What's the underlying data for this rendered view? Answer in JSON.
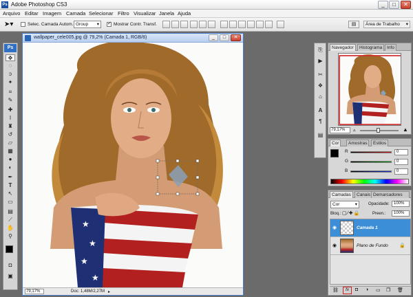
{
  "app": {
    "title": "Adobe Photoshop CS3",
    "logo": "Ps"
  },
  "window_controls": {
    "minimize": "_",
    "maximize": "□",
    "close": "✕"
  },
  "menu": [
    "Arquivo",
    "Editar",
    "Imagem",
    "Camada",
    "Selecionar",
    "Filtro",
    "Visualizar",
    "Janela",
    "Ajuda"
  ],
  "options_bar": {
    "auto_select_label": "Selec. Camada Autom.",
    "auto_select_value": "Group",
    "show_transform_label": "Mostrar Contr. Transf.",
    "workspace_label": "Área de Trabalho"
  },
  "document": {
    "title": "wallpaper_cele005.jpg @ 79,2% (Camada 1, RGB/8)",
    "zoom": "79,17%",
    "doc_info": "Doc: 1,48M/2,27M"
  },
  "navigator": {
    "tabs": [
      "Navegador",
      "Histograma",
      "Info"
    ],
    "zoom": "79,17%"
  },
  "color_panel": {
    "tabs": [
      "Cor",
      "Amostras",
      "Estilos"
    ],
    "channels": [
      {
        "label": "R",
        "value": "0"
      },
      {
        "label": "G",
        "value": "0"
      },
      {
        "label": "B",
        "value": "0"
      }
    ],
    "colors": {
      "red": "#d01818",
      "green": "#18a018",
      "blue": "#1838d0"
    }
  },
  "layers_panel": {
    "tabs": [
      "Camadas",
      "Canais",
      "Demarcadores"
    ],
    "blend_mode": "Cor",
    "opacity_label": "Opacidade:",
    "opacity_value": "100%",
    "lock_label": "Bloq.:",
    "fill_label": "Preen.:",
    "fill_value": "100%",
    "layers": [
      {
        "name": "Camada 1",
        "selected": true
      },
      {
        "name": "Plano de Fundo",
        "selected": false,
        "locked": true
      }
    ],
    "selection_color": "#3c8fd6"
  }
}
